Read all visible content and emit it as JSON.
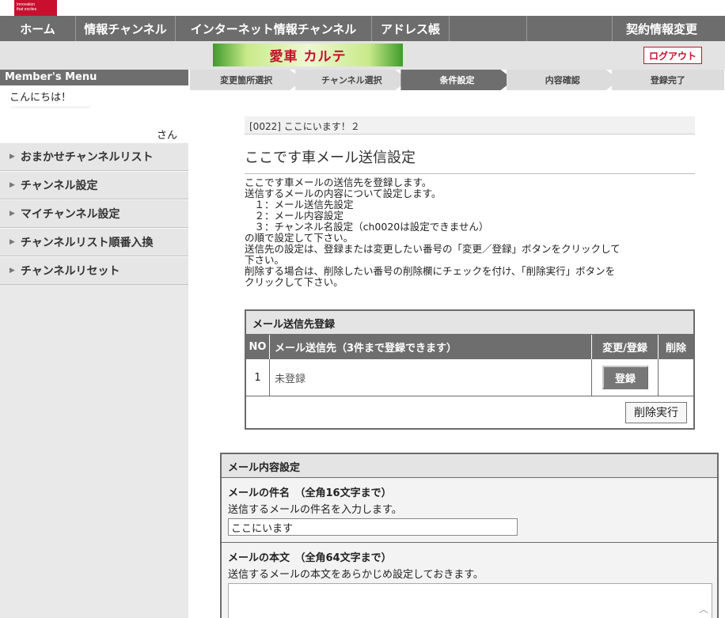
{
  "brand": {
    "logo_line1": "Innovation",
    "logo_line2": "that excites"
  },
  "nav": [
    "ホーム",
    "情報チャンネル",
    "インターネット情報チャンネル",
    "アドレス帳",
    "",
    "",
    "契約情報変更"
  ],
  "banner": {
    "title": "愛車 カルテ"
  },
  "logout": "ログアウト",
  "sidebar": {
    "header": "Member's Menu",
    "greeting": "こんにちは！",
    "suffix": "さん",
    "items": [
      "おまかせチャンネルリスト",
      "チャンネル設定",
      "マイチャンネル設定",
      "チャンネルリスト順番入換",
      "チャンネルリセット"
    ]
  },
  "steps": [
    "変更箇所選択",
    "チャンネル選択",
    "条件設定",
    "内容確認",
    "登録完了"
  ],
  "breadcrumb": "[0022] ここにいます！２",
  "page_title": "ここです車メール送信設定",
  "description": [
    "ここです車メールの送信先を登録します。",
    "送信するメールの内容について設定します。",
    "　１：メール送信先設定",
    "　２：メール内容設定",
    "　３：チャンネル名設定（ch0020は設定できません）",
    "の順で設定して下さい。",
    "送信先の設定は、登録または変更したい番号の「変更／登録」ボタンをクリックして",
    "下さい。",
    "削除する場合は、削除したい番号の削除欄にチェックを付け、「削除実行」ボタンを",
    "クリックして下さい。"
  ],
  "recipients": {
    "title": "メール送信先登録",
    "columns": {
      "no": "NO",
      "address": "メール送信先（3件まで登録できます）",
      "register": "変更/登録",
      "delete": "削除"
    },
    "rows": [
      {
        "no": "1",
        "address": "未登録",
        "button": "登録"
      }
    ],
    "delete_button": "削除実行"
  },
  "mail_content": {
    "title": "メール内容設定",
    "subject_label": "メールの件名　（全角16文字まで）",
    "subject_hint": "送信するメールの件名を入力します。",
    "subject_value": "ここにいます",
    "body_label": "メールの本文　（全角64文字まで）",
    "body_hint": "送信するメールの本文をあらかじめ設定しておきます。",
    "body_value": ""
  }
}
